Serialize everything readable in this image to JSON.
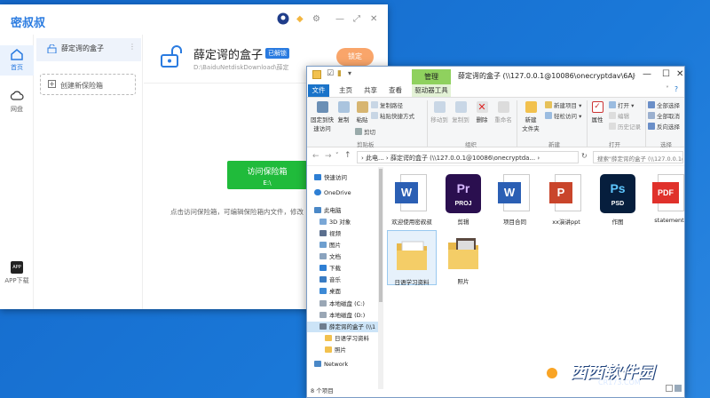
{
  "app": {
    "title": "密叔叔",
    "left_nav": {
      "home": "首页",
      "cloud": "网盘",
      "app_download": "APP下载",
      "app_badge": "APP"
    },
    "vault_list": {
      "item": "薛定谔的盒子",
      "more": "⋮",
      "create": "创建新保险箱"
    },
    "vault": {
      "name": "薛定谔的盒子",
      "badge": "已解锁",
      "path": "D:\\BaiduNetdiskDownload\\薛定",
      "lock_button": "锁定",
      "visit_button": "访问保险箱",
      "visit_drive": "E:\\",
      "hint": "点击访问保险箱，可编辑保险箱内文件，修改"
    }
  },
  "explorer": {
    "manage_tab": "管理",
    "title": "薛定谔的盒子 (\\\\127.0.0.1@10086\\onecryptdav\\6AJC7EK1CU...",
    "tabs": [
      "文件",
      "主页",
      "共享",
      "查看",
      "驱动器工具"
    ],
    "ribbon": {
      "clipboard": {
        "pin": "固定到快\n速访问",
        "copy": "复制",
        "paste": "粘贴",
        "copy_path": "复制路径",
        "paste_shortcut": "粘贴快捷方式",
        "cut": "剪切",
        "label": "剪贴板"
      },
      "organize": {
        "move_to": "移动到",
        "copy_to": "复制到",
        "delete": "删除",
        "rename": "重命名",
        "label": "组织"
      },
      "new": {
        "new_folder": "新建\n文件夹",
        "new_item": "新建项目 ▾",
        "easy_access": "轻松访问 ▾",
        "label": "新建"
      },
      "open": {
        "properties": "属性",
        "open": "打开 ▾",
        "edit": "编辑",
        "history": "历史记录",
        "label": "打开"
      },
      "select": {
        "select_all": "全部选择",
        "select_none": "全部取消",
        "invert": "反向选择",
        "label": "选择"
      }
    },
    "address": "› 此电... › 薛定谔的盒子 (\\\\127.0.0.1@10086\\onecryptda... ›",
    "search_placeholder": "搜索\"薛定谔的盒子 (\\\\127.0.0.1@...",
    "nav": [
      "快速访问",
      "OneDrive",
      "此电脑",
      "3D 对象",
      "视频",
      "图片",
      "文档",
      "下载",
      "音乐",
      "桌面",
      "本地磁盘 (C:)",
      "本地磁盘 (D:)",
      "薛定谔的盒子 (\\\\1",
      "日语学习资料",
      "照片",
      "Network"
    ],
    "files": [
      {
        "name": "欢迎使用密叔叔",
        "logo": "W"
      },
      {
        "name": "剪辑",
        "logo": "Pr",
        "sub": "PROJ"
      },
      {
        "name": "项目合同",
        "logo": "W"
      },
      {
        "name": "xx演讲ppt",
        "logo": "P"
      },
      {
        "name": "作图",
        "logo": "Ps",
        "sub": "PSD"
      },
      {
        "name": "statement",
        "logo": "PDF"
      },
      {
        "name": "日语学习资料"
      },
      {
        "name": "照片"
      }
    ],
    "status": "8 个项目"
  },
  "watermark": {
    "text": "西西软件园",
    "url": "CR173.COM"
  },
  "colors": {
    "accent": "#2a7be0",
    "green_button": "#20bb3b",
    "lock_button": "#f9a56a",
    "file_tab": "#1a73c9"
  }
}
